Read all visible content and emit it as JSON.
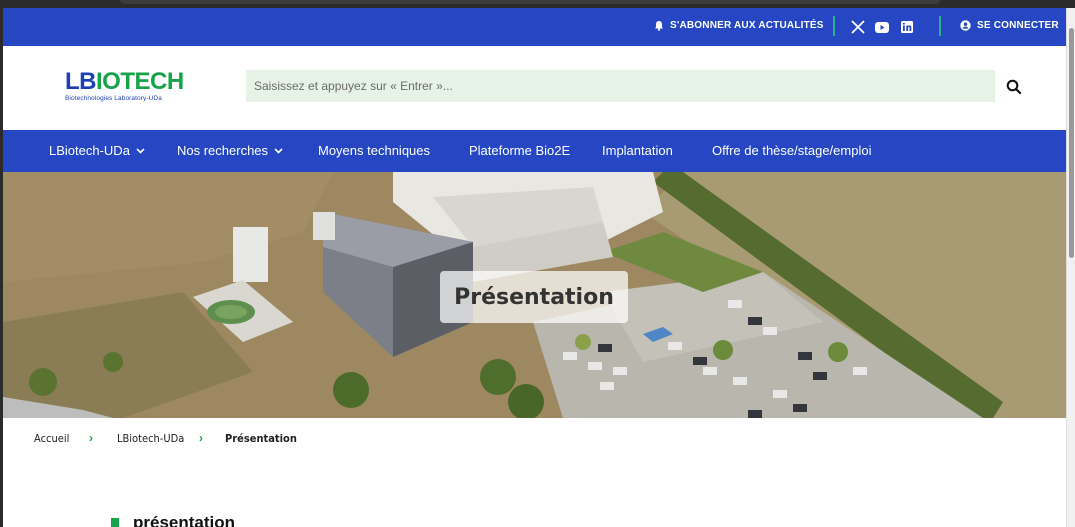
{
  "topbar": {
    "subscribe_label": "S'ABONNER AUX ACTUALITÉS",
    "login_label": "SE CONNECTER",
    "social": [
      "x-icon",
      "youtube-icon",
      "linkedin-icon"
    ]
  },
  "header": {
    "logo_text_a": "LB",
    "logo_text_b": "IO",
    "logo_text_c": "TECH",
    "logo_subtitle": "Biotechnologies Laboratory-UDa",
    "search_placeholder": "Saisissez et appuyez sur « Entrer »..."
  },
  "nav": {
    "items": [
      {
        "label": "LBiotech-UDa",
        "dropdown": true
      },
      {
        "label": "Nos recherches",
        "dropdown": true
      },
      {
        "label": "Moyens techniques",
        "dropdown": false
      },
      {
        "label": "Plateforme Bio2E",
        "dropdown": false
      },
      {
        "label": "Implantation",
        "dropdown": false
      },
      {
        "label": "Offre de thèse/stage/emploi",
        "dropdown": false
      }
    ]
  },
  "hero": {
    "title": "Présentation"
  },
  "breadcrumb": {
    "items": [
      "Accueil",
      "LBiotech-UDa",
      "Présentation"
    ]
  },
  "content": {
    "section_title": "présentation"
  },
  "colors": {
    "primary_blue": "#2646c4",
    "accent_green": "#16a34a",
    "search_bg": "#e6f2e6"
  }
}
